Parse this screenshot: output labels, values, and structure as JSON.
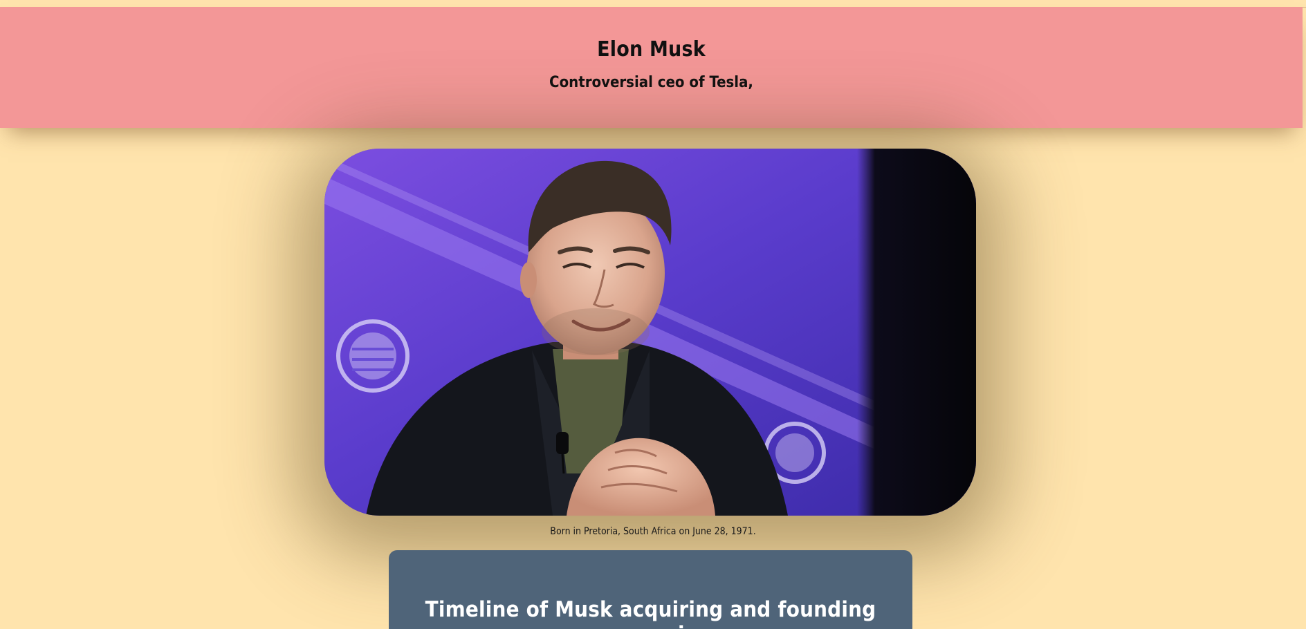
{
  "header": {
    "title": "Elon Musk",
    "subtitle": "Controversial ceo of Tesla,"
  },
  "hero_image": {
    "icon": "portrait-photo"
  },
  "caption": "Born in Pretoria, South Africa on June 28, 1971.",
  "timeline": {
    "heading": "Timeline of Musk acquiring and founding companies"
  },
  "colors": {
    "page_bg": "#ffe4ad",
    "header_bg": "#f39797",
    "card_bg": "#4f6479",
    "stage_purple": "#5b3fd0"
  }
}
